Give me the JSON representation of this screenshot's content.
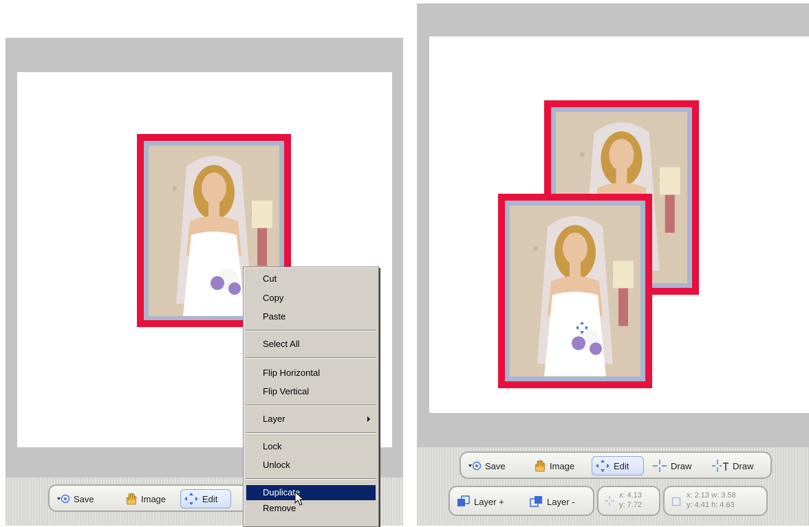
{
  "left_view": {
    "context_menu": {
      "items": [
        {
          "label": "Cut"
        },
        {
          "label": "Copy"
        },
        {
          "label": "Paste"
        },
        {
          "label": "Select All"
        },
        {
          "label": "Flip Horizontal"
        },
        {
          "label": "Flip Vertical"
        },
        {
          "label": "Layer",
          "has_submenu": true
        },
        {
          "label": "Lock"
        },
        {
          "label": "Unlock"
        },
        {
          "label": "Duplicate",
          "selected": true
        },
        {
          "label": "Remove"
        }
      ]
    },
    "toolbar": {
      "save_label": "Save",
      "image_label": "Image",
      "edit_label": "Edit",
      "active_tool": "Edit"
    }
  },
  "right_view": {
    "toolbar": {
      "save_label": "Save",
      "image_label": "Image",
      "edit_label": "Edit",
      "draw_label": "Draw",
      "text_draw_label": "Draw",
      "active_tool": "Edit"
    },
    "toolbar2": {
      "layer_up_label": "Layer +",
      "layer_down_label": "Layer -",
      "pos_x": "x: 4.13",
      "pos_y": "y: 7.72",
      "sel_xw": "x: 2.13 w: 3.58",
      "sel_yh": "y: 4.41 h: 4.63"
    }
  },
  "colors": {
    "frame_red": "#e8103c",
    "mat_blue": "#a8b6d0",
    "menu_highlight": "#0a246a",
    "workspace_gray": "#c4c4c4"
  }
}
